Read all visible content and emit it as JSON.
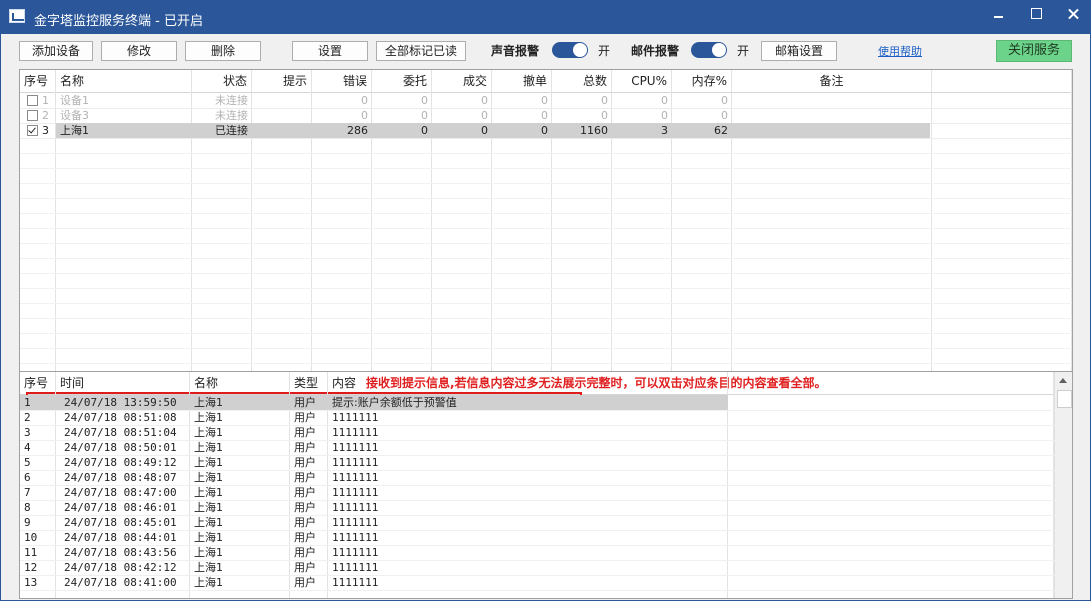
{
  "window": {
    "title": "金字塔监控服务终端 - 已开启"
  },
  "toolbar": {
    "add_device": "添加设备",
    "edit": "修改",
    "delete": "删除",
    "settings": "设置",
    "mark_all_read": "全部标记已读",
    "sound_alarm_label": "声音报警",
    "sound_alarm_state": "开",
    "mail_alarm_label": "邮件报警",
    "mail_alarm_state": "开",
    "mailbox_settings": "邮箱设置",
    "help": "使用帮助",
    "close_service": "关闭服务"
  },
  "device_table": {
    "columns": [
      "序号",
      "名称",
      "状态",
      "提示",
      "错误",
      "委托",
      "成交",
      "撤单",
      "总数",
      "CPU%",
      "内存%",
      "备注"
    ],
    "rows": [
      {
        "checked": false,
        "index": "1",
        "name": "设备1",
        "status": "未连接",
        "hint": "",
        "error": "0",
        "order": "0",
        "deal": "0",
        "cancel": "0",
        "total": "0",
        "cpu": "0",
        "mem": "0",
        "remark": ""
      },
      {
        "checked": false,
        "index": "2",
        "name": "设备3",
        "status": "未连接",
        "hint": "",
        "error": "0",
        "order": "0",
        "deal": "0",
        "cancel": "0",
        "total": "0",
        "cpu": "0",
        "mem": "0",
        "remark": ""
      },
      {
        "checked": true,
        "index": "3",
        "name": "上海1",
        "status": "已连接",
        "hint": "",
        "error": "286",
        "order": "0",
        "deal": "0",
        "cancel": "0",
        "total": "1160",
        "cpu": "3",
        "mem": "62",
        "remark": ""
      }
    ]
  },
  "log_table": {
    "columns": [
      "序号",
      "时间",
      "名称",
      "类型",
      "内容"
    ],
    "annotation": "接收到提示信息,若信息内容过多无法展示完整时，可以双击对应条目的内容查看全部。",
    "rows": [
      {
        "index": "1",
        "time": "24/07/18 13:59:50",
        "name": "上海1",
        "type": "用户",
        "content": "提示:账户余额低于预警值"
      },
      {
        "index": "2",
        "time": "24/07/18 08:51:08",
        "name": "上海1",
        "type": "用户",
        "content": "1111111"
      },
      {
        "index": "3",
        "time": "24/07/18 08:51:04",
        "name": "上海1",
        "type": "用户",
        "content": "1111111"
      },
      {
        "index": "4",
        "time": "24/07/18 08:50:01",
        "name": "上海1",
        "type": "用户",
        "content": "1111111"
      },
      {
        "index": "5",
        "time": "24/07/18 08:49:12",
        "name": "上海1",
        "type": "用户",
        "content": "1111111"
      },
      {
        "index": "6",
        "time": "24/07/18 08:48:07",
        "name": "上海1",
        "type": "用户",
        "content": "1111111"
      },
      {
        "index": "7",
        "time": "24/07/18 08:47:00",
        "name": "上海1",
        "type": "用户",
        "content": "1111111"
      },
      {
        "index": "8",
        "time": "24/07/18 08:46:01",
        "name": "上海1",
        "type": "用户",
        "content": "1111111"
      },
      {
        "index": "9",
        "time": "24/07/18 08:45:01",
        "name": "上海1",
        "type": "用户",
        "content": "1111111"
      },
      {
        "index": "10",
        "time": "24/07/18 08:44:01",
        "name": "上海1",
        "type": "用户",
        "content": "1111111"
      },
      {
        "index": "11",
        "time": "24/07/18 08:43:56",
        "name": "上海1",
        "type": "用户",
        "content": "1111111"
      },
      {
        "index": "12",
        "time": "24/07/18 08:42:12",
        "name": "上海1",
        "type": "用户",
        "content": "1111111"
      },
      {
        "index": "13",
        "time": "24/07/18 08:41:00",
        "name": "上海1",
        "type": "用户",
        "content": "1111111"
      }
    ]
  },
  "colors": {
    "titlebar": "#2b579a",
    "toggle": "#2b579a",
    "close_service": "#6cd38a",
    "highlight_box": "#e01b1b",
    "annotation": "#e02020",
    "selected_row": "#d0d0d0"
  }
}
